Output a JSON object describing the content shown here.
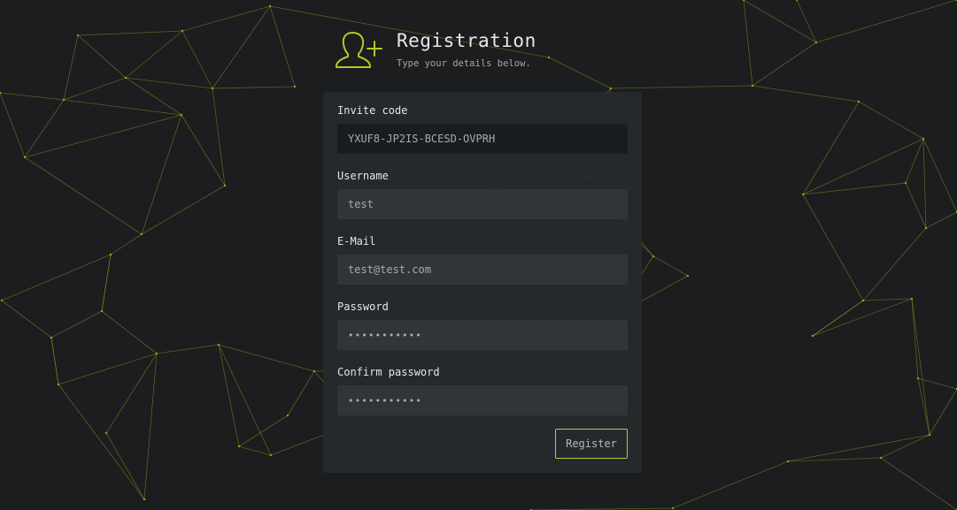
{
  "theme": {
    "accent": "#b3c92a",
    "background": "#1b1d1f",
    "card": "#272a2d",
    "input": "#31353a",
    "input_dark": "#1a1d20"
  },
  "header": {
    "icon": "user-plus-icon",
    "title": "Registration",
    "subtitle": "Type your details below."
  },
  "form": {
    "invite_code": {
      "label": "Invite code",
      "value": "YXUF8-JP2IS-BCESD-OVPRH"
    },
    "username": {
      "label": "Username",
      "value": "test"
    },
    "email": {
      "label": "E-Mail",
      "value": "test@test.com"
    },
    "password": {
      "label": "Password",
      "value": "•••••••••••"
    },
    "confirm_password": {
      "label": "Confirm password",
      "value": "•••••••••••"
    },
    "submit_label": "Register"
  }
}
